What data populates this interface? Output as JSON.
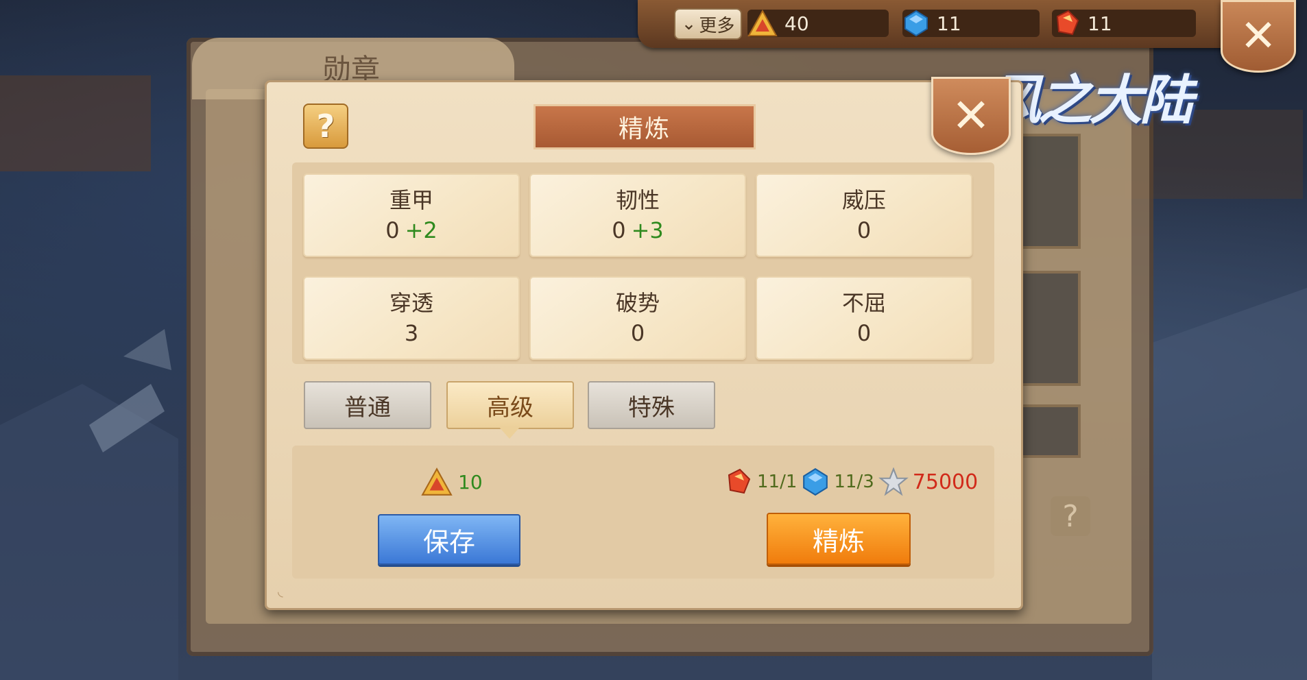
{
  "background": {
    "panel_title": "勋章"
  },
  "topbar": {
    "more_label": "更多",
    "currencies": [
      {
        "icon": "gold-triangle-icon",
        "value": "40"
      },
      {
        "icon": "blue-gem-icon",
        "value": "11"
      },
      {
        "icon": "red-crystal-icon",
        "value": "11"
      }
    ]
  },
  "logo": {
    "text": "风之大陆"
  },
  "dialog": {
    "title": "精炼",
    "attributes": [
      {
        "name": "重甲",
        "value": "0",
        "bonus": "+2"
      },
      {
        "name": "韧性",
        "value": "0",
        "bonus": "+3"
      },
      {
        "name": "威压",
        "value": "0",
        "bonus": ""
      },
      {
        "name": "穿透",
        "value": "3",
        "bonus": ""
      },
      {
        "name": "破势",
        "value": "0",
        "bonus": ""
      },
      {
        "name": "不屈",
        "value": "0",
        "bonus": ""
      }
    ],
    "tabs": [
      {
        "label": "普通",
        "active": false
      },
      {
        "label": "高级",
        "active": true
      },
      {
        "label": "特殊",
        "active": false
      }
    ],
    "cost_left": {
      "icon": "gold-triangle-icon",
      "value": "10"
    },
    "cost_right": {
      "red_crystal": "11/1",
      "blue_gem": "11/3",
      "silver": "75000"
    },
    "save_label": "保存",
    "refine_label": "精炼"
  },
  "colors": {
    "bonus_green": "#2f8a1e",
    "silver_red": "#d12a1a",
    "save_blue": "#3b78d6",
    "refine_orange": "#f07c0c"
  }
}
